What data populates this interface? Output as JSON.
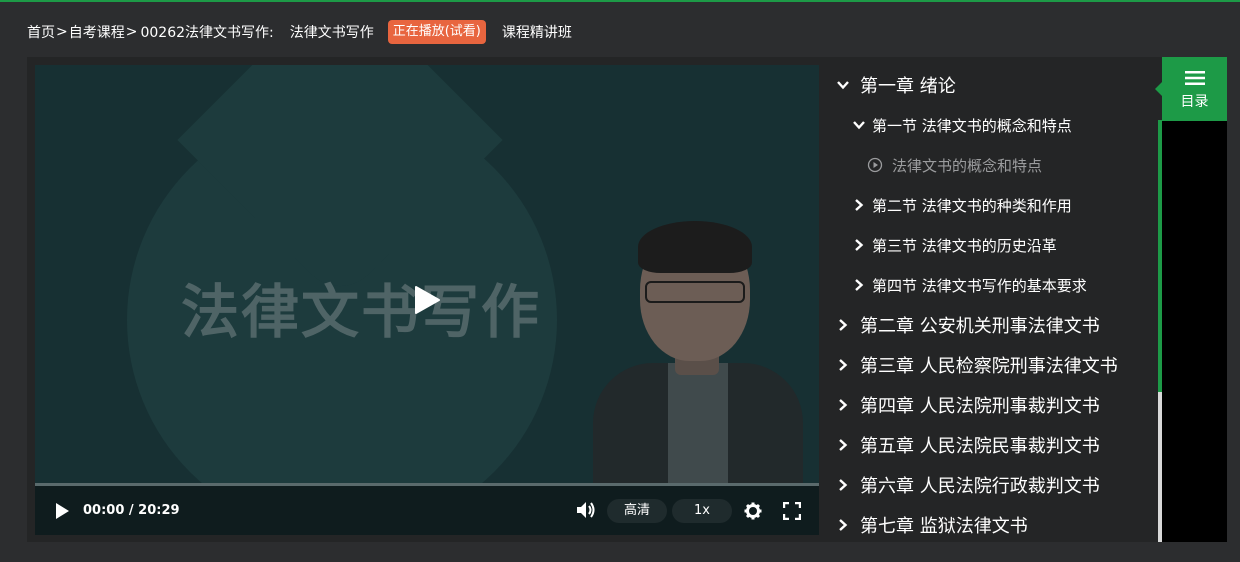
{
  "breadcrumb": {
    "home": "首页",
    "sep1": ">",
    "category": "自考课程",
    "sep2": ">",
    "course": "00262法律文书写作:",
    "lesson": "法律文书写作",
    "status_badge": "正在播放(试看)",
    "class_type": "课程精讲班"
  },
  "video": {
    "slide_title": "法律文书写作",
    "time_display": "00:00 / 20:29",
    "quality_label": "高清",
    "speed_label": "1x",
    "progress": 0
  },
  "side_tab": {
    "label": "目录",
    "icon": "menu-icon"
  },
  "catalog": [
    {
      "type": "chapter",
      "expanded": true,
      "label": "第一章 绪论"
    },
    {
      "type": "section",
      "expanded": true,
      "label": "第一节 法律文书的概念和特点"
    },
    {
      "type": "lesson",
      "label": "法律文书的概念和特点"
    },
    {
      "type": "section",
      "expanded": false,
      "label": "第二节 法律文书的种类和作用"
    },
    {
      "type": "section",
      "expanded": false,
      "label": "第三节 法律文书的历史沿革"
    },
    {
      "type": "section",
      "expanded": false,
      "label": "第四节 法律文书写作的基本要求"
    },
    {
      "type": "chapter",
      "expanded": false,
      "label": "第二章 公安机关刑事法律文书"
    },
    {
      "type": "chapter",
      "expanded": false,
      "label": "第三章 人民检察院刑事法律文书"
    },
    {
      "type": "chapter",
      "expanded": false,
      "label": "第四章 人民法院刑事裁判文书"
    },
    {
      "type": "chapter",
      "expanded": false,
      "label": "第五章 人民法院民事裁判文书"
    },
    {
      "type": "chapter",
      "expanded": false,
      "label": "第六章 人民法院行政裁判文书"
    },
    {
      "type": "chapter",
      "expanded": false,
      "label": "第七章 监狱法律文书"
    }
  ],
  "colors": {
    "accent": "#1d9a47",
    "badge": "#e8653f",
    "background": "#2c2d2f",
    "panel": "#242526"
  }
}
